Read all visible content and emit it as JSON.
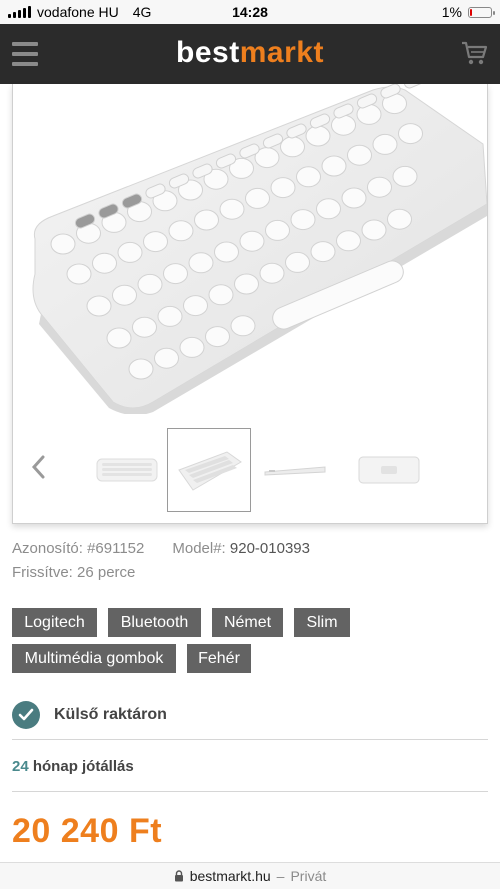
{
  "statusbar": {
    "carrier": "vodafone HU",
    "network": "4G",
    "time": "14:28",
    "battery": "1%",
    "battery_level": 0.01
  },
  "header": {
    "logo_part1": "best",
    "logo_part2": "markt",
    "menu_icon": "hamburger-menu-icon",
    "cart_icon": "cart-icon"
  },
  "gallery": {
    "prev_icon": "chevron-left-icon",
    "thumbnails": [
      "keyboard-top-view",
      "keyboard-angle-view",
      "keyboard-side-view",
      "keyboard-bottom-view"
    ],
    "active_index": 1
  },
  "meta": {
    "id_label": "Azonosító:",
    "id_value": "#691152",
    "model_label": "Model#:",
    "model_value": "920-010393",
    "updated": "Frissítve: 26 perce"
  },
  "tags": [
    "Logitech",
    "Bluetooth",
    "Német",
    "Slim",
    "Multimédia gombok",
    "Fehér"
  ],
  "stock": {
    "label": "Külső raktáron",
    "icon": "check-circle-icon"
  },
  "warranty": {
    "months": "24",
    "text": "hónap jótállás"
  },
  "price": "20 240 Ft",
  "urlbar": {
    "domain": "bestmarkt.hu",
    "separator": "–",
    "mode": "Privát",
    "icon": "lock-icon"
  },
  "colors": {
    "accent": "#ee7f1e",
    "header_bg": "#2b2b2b",
    "tag_bg": "#636363",
    "check": "#4a7c80"
  }
}
